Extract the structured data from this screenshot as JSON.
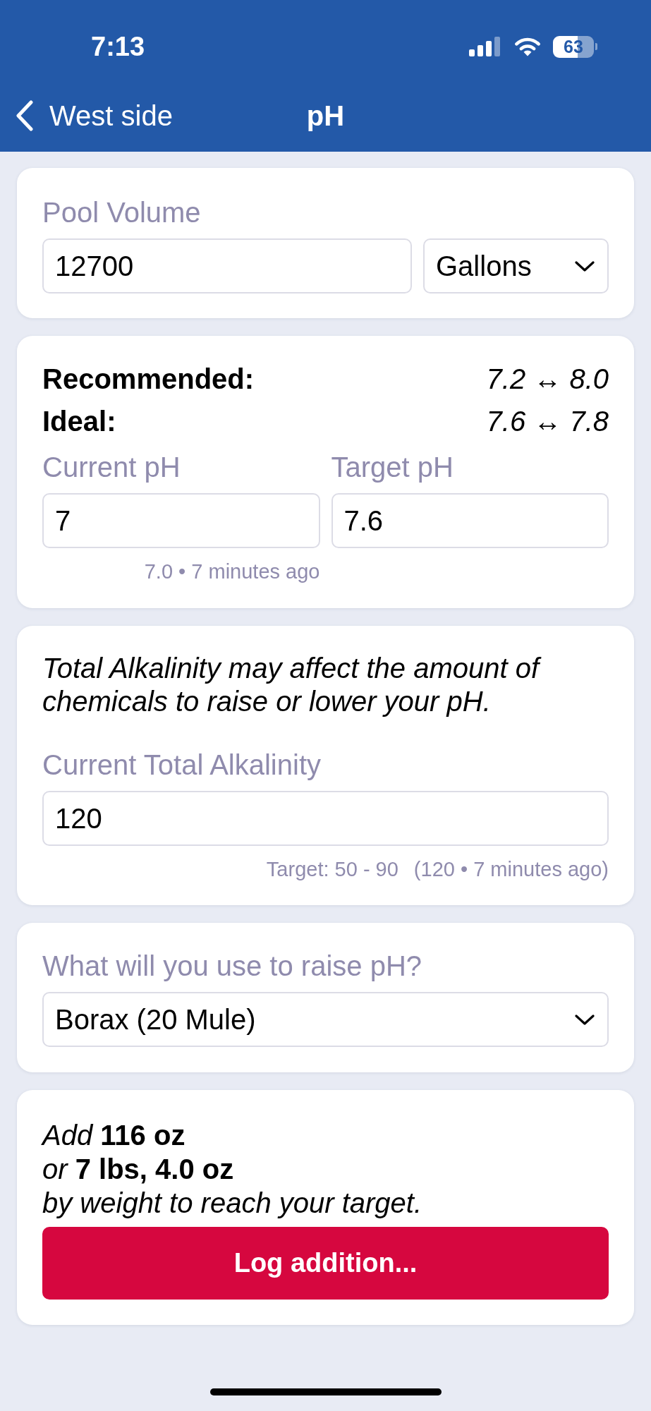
{
  "status_bar": {
    "time": "7:13",
    "battery": "63"
  },
  "nav_bar": {
    "back_label": "West side",
    "title": "pH"
  },
  "pool_volume": {
    "label": "Pool Volume",
    "value": "12700",
    "unit": "Gallons"
  },
  "ranges": [
    {
      "label": "Recommended:",
      "value": "7.2 ↔ 8.0"
    },
    {
      "label": "Ideal:",
      "value": "7.6 ↔ 7.8"
    }
  ],
  "ph_fields": [
    {
      "label": "Current pH",
      "value": "7",
      "hint": "7.0 • 7 minutes ago"
    },
    {
      "label": "Target pH",
      "value": "7.6"
    }
  ],
  "alkalinity": {
    "note": "Total Alkalinity may affect the amount of chemicals to raise or lower your pH.",
    "label": "Current Total Alkalinity",
    "value": "120",
    "target": "Target: 50 - 90",
    "last_reading": "(120 • 7 minutes ago)"
  },
  "chemical": {
    "label": "What will you use to raise pH?",
    "value": "Borax (20 Mule)"
  },
  "result": {
    "text": "*Add* **116 oz**\n*or* **7 lbs, 4.0 oz**\n*by weight to reach your target.*",
    "button": "Log addition..."
  }
}
